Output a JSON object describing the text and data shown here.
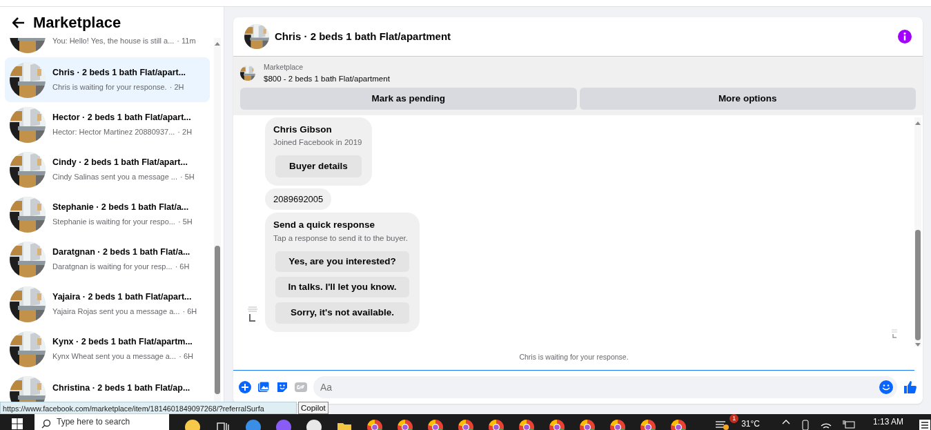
{
  "sidebar": {
    "title": "Marketplace",
    "conversations": [
      {
        "preview": "You: Hello! Yes, the house is still a...",
        "time": "· 11m",
        "selected": false
      },
      {
        "title": "Chris · 2 beds 1 bath Flat/apart...",
        "preview": "Chris is waiting for your response.",
        "time": "· 2H",
        "selected": true
      },
      {
        "title": "Hector · 2 beds 1 bath Flat/apart...",
        "preview": "Hector: Hector Martinez 20880937...",
        "time": "· 2H",
        "selected": false
      },
      {
        "title": "Cindy · 2 beds 1 bath Flat/apart...",
        "preview": "Cindy Salinas sent you a message ...",
        "time": "· 5H",
        "selected": false
      },
      {
        "title": "Stephanie · 2 beds 1 bath Flat/a...",
        "preview": "Stephanie is waiting for your respo...",
        "time": "· 5H",
        "selected": false
      },
      {
        "title": "Daratgnan · 2 beds 1 bath Flat/a...",
        "preview": "Daratgnan is waiting for your resp...",
        "time": "· 6H",
        "selected": false
      },
      {
        "title": "Yajaira · 2 beds 1 bath Flat/apart...",
        "preview": "Yajaira Rojas sent you a message a...",
        "time": "· 6H",
        "selected": false
      },
      {
        "title": "Kynx · 2 beds 1 bath Flat/apartm...",
        "preview": "Kynx Wheat sent you a message a...",
        "time": "· 6H",
        "selected": false
      },
      {
        "title": "Christina · 2 beds 1 bath Flat/ap...",
        "selected": false
      }
    ]
  },
  "conversation": {
    "title": "Chris · 2 beds 1 bath Flat/apartment",
    "listing": {
      "source": "Marketplace",
      "summary": "$800 - 2 beds 1 bath Flat/apartment"
    },
    "actions": [
      "Mark as pending",
      "More options"
    ],
    "messages": [
      {
        "kind": "buyer_card",
        "name": "Chris Gibson",
        "subtitle": "Joined Facebook in 2019",
        "button": "Buyer details"
      },
      {
        "kind": "text",
        "text": "2089692005"
      },
      {
        "kind": "quick_replies",
        "title": "Send a quick response",
        "subtitle": "Tap a response to send it to the buyer.",
        "options": [
          "Yes, are you interested?",
          "In talks. I'll let you know.",
          "Sorry, it's not available."
        ]
      }
    ],
    "status": "Chris is waiting for your response.",
    "composer": {
      "placeholder": "Aa"
    }
  },
  "browser_status": {
    "url": "https://www.facebook.com/marketplace/item/1814601849097268/?referralSurfa",
    "tooltip": "Copilot"
  },
  "taskbar": {
    "search_placeholder": "Type here to search",
    "weather_badge": "1",
    "weather": "31°C",
    "time": "1:13 AM"
  }
}
